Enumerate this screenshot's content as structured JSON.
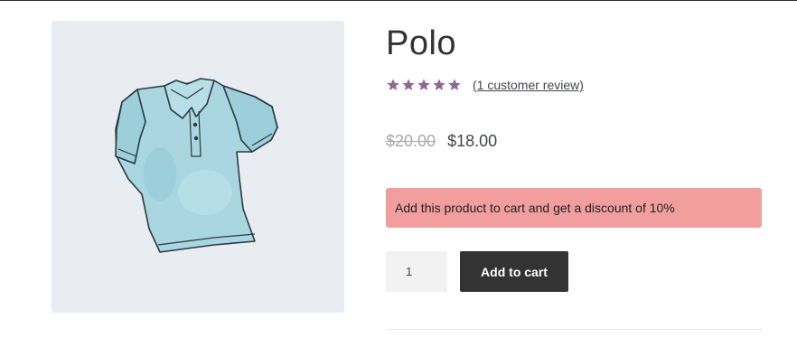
{
  "product": {
    "title": "Polo",
    "image_subject": "Light blue polo shirt illustration",
    "zoom_icon": "zoom-in-icon",
    "rating": {
      "stars": 5,
      "star_color": "#8e6a8e",
      "review_text": "(1 customer review)"
    },
    "price": {
      "regular": "$20.00",
      "sale": "$18.00"
    },
    "notice": {
      "text": "Add this product to cart and get a discount of 10%",
      "background": "#f29e9e"
    },
    "quantity": {
      "value": "1"
    },
    "add_to_cart_label": "Add to cart"
  }
}
